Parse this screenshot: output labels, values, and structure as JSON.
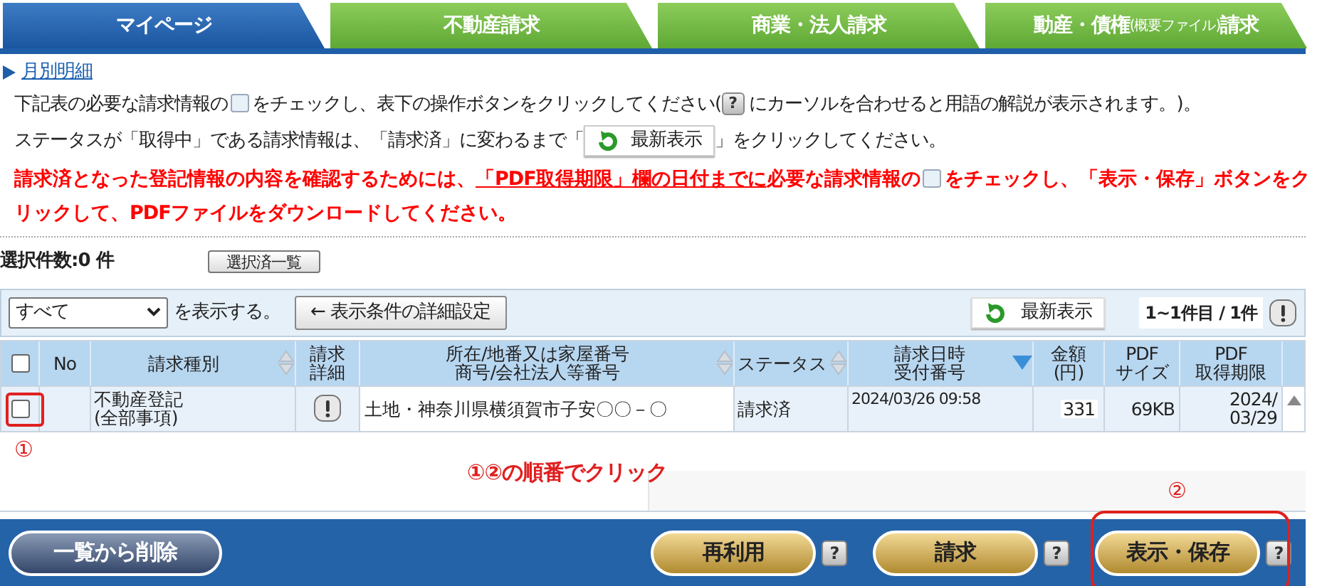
{
  "tabs": [
    {
      "label": "マイページ",
      "selected": true
    },
    {
      "label": "不動産請求",
      "selected": false
    },
    {
      "label": "商業・法人請求",
      "selected": false
    },
    {
      "label": "動産・債権",
      "note": "(概要ファイル)",
      "tail": "請求",
      "selected": false
    }
  ],
  "link": "月別明細",
  "instructions": [
    {
      "kind": "plain",
      "parts": [
        {
          "kind": "text",
          "text": "下記表の必要な請求情報の"
        },
        {
          "kind": "checkbox-icon"
        },
        {
          "kind": "text",
          "text": "をチェックし、表下の操作ボタンをクリックしてください("
        },
        {
          "kind": "help-icon",
          "text": "?"
        },
        {
          "kind": "text",
          "text": " にカーソルを合わせると用語の解説が表示されます。)。"
        }
      ]
    },
    {
      "kind": "plain",
      "parts": [
        {
          "kind": "text",
          "text": "ステータスが「取得中」である請求情報は、「請求済」に変わるまで「"
        },
        {
          "kind": "refresh-button",
          "text": "最新表示"
        },
        {
          "kind": "text",
          "text": "」をクリックしてください。"
        }
      ]
    },
    {
      "kind": "warning",
      "parts": [
        {
          "kind": "text",
          "text": "請求済となった登記情報の内容を確認するためには、"
        },
        {
          "kind": "underline",
          "text": "「PDF取得期限」欄の日付までに"
        },
        {
          "kind": "text",
          "text": "必要な請求情報の"
        },
        {
          "kind": "checkbox-icon"
        },
        {
          "kind": "text",
          "text": "をチェックし、「表示・保存」ボタンをクリックして、PDFファイルをダウンロードしてください。"
        }
      ]
    }
  ],
  "selection": {
    "label": "選択件数:0 件",
    "button": "選択済一覧"
  },
  "filter": {
    "value": "すべて",
    "suffix": "を表示する。",
    "detail_button": "← 表示条件の詳細設定",
    "refresh_button": "最新表示",
    "count": "1~1件目 / 1件"
  },
  "table": {
    "select_all_checked": false,
    "columns": [
      {
        "label": [
          "No"
        ],
        "sortable": false
      },
      {
        "label": [
          "請求種別"
        ],
        "sortable": true,
        "sorted": false
      },
      {
        "label": [
          "請求",
          "詳細"
        ],
        "sortable": false
      },
      {
        "label": [
          "所在/地番又は家屋番号",
          "商号/会社法人等番号"
        ],
        "sortable": true,
        "sorted": false
      },
      {
        "label": [
          "ステータス"
        ],
        "sortable": true,
        "sorted": false
      },
      {
        "label": [
          "請求日時",
          "受付番号"
        ],
        "sortable": true,
        "sorted": true
      },
      {
        "label": [
          "金額",
          "(円)"
        ],
        "sortable": false
      },
      {
        "label": [
          "PDF",
          "サイズ"
        ],
        "sortable": false
      },
      {
        "label": [
          "PDF",
          "取得期限"
        ],
        "sortable": false
      }
    ],
    "rows": [
      {
        "checked": false,
        "type": "不動産登記\n(全部事項)",
        "location": "土地・神奈川県横須賀市子安〇〇－〇",
        "status": "請求済",
        "datetime": "2024/03/26 09:58",
        "amount": "331",
        "size": "69KB",
        "deadline": "2024/\n03/29"
      }
    ]
  },
  "annotations": {
    "step1": "①",
    "instruction": "①②の順番でクリック",
    "step2": "②"
  },
  "footer": {
    "delete_button": "一覧から削除",
    "buttons": [
      {
        "label": "再利用",
        "help": "?"
      },
      {
        "label": "請求",
        "help": "?"
      },
      {
        "label": "表示・保存",
        "help": "?"
      }
    ]
  }
}
